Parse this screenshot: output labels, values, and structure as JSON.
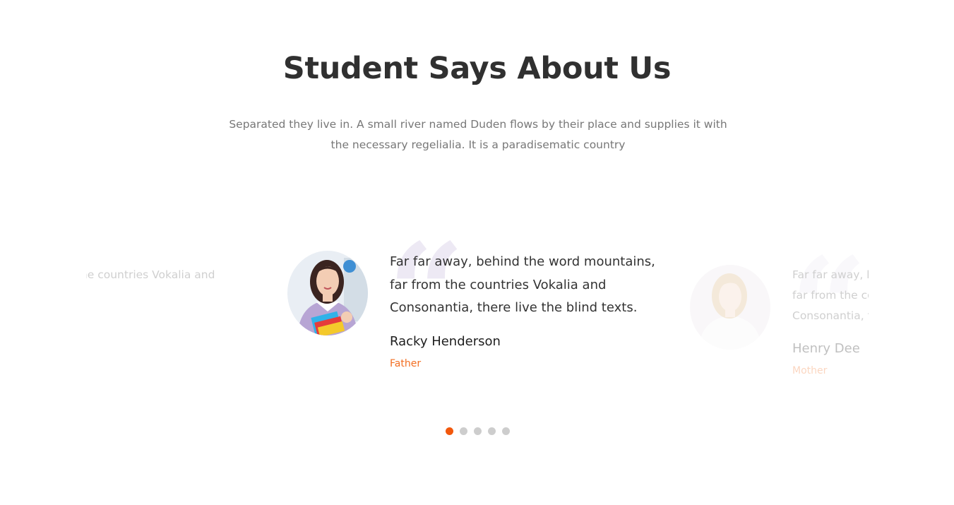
{
  "section": {
    "title": "Student Says About Us",
    "subtitle": "Separated they live in. A small river named Duden flows by their place and supplies it with the necessary regelialia. It is a paradisematic country"
  },
  "testimonials": [
    {
      "quote": "Far far away, behind the word mountains, far from the countries Vokalia and Consonantia, there live the blind texts.",
      "name": "",
      "role": "",
      "state": "previous"
    },
    {
      "quote": "Far far away, behind the word mountains, far from the countries Vokalia and Consonantia, there live the blind texts.",
      "name": "Racky Henderson",
      "role": "Father",
      "state": "active"
    },
    {
      "quote": "Far far away, behind the word mountains, far from the countries Vokalia and Consonantia, there live the blind texts.",
      "name": "Henry Dee",
      "role": "Mother",
      "state": "next"
    }
  ],
  "quote_icon": "quote-icon",
  "pagination": {
    "count": 5,
    "active": 1
  },
  "colors": {
    "accent": "#f2580c",
    "role_text": "#f26e22",
    "quote_mark": "#ede9f4",
    "dot_inactive": "#cdcdcd"
  }
}
